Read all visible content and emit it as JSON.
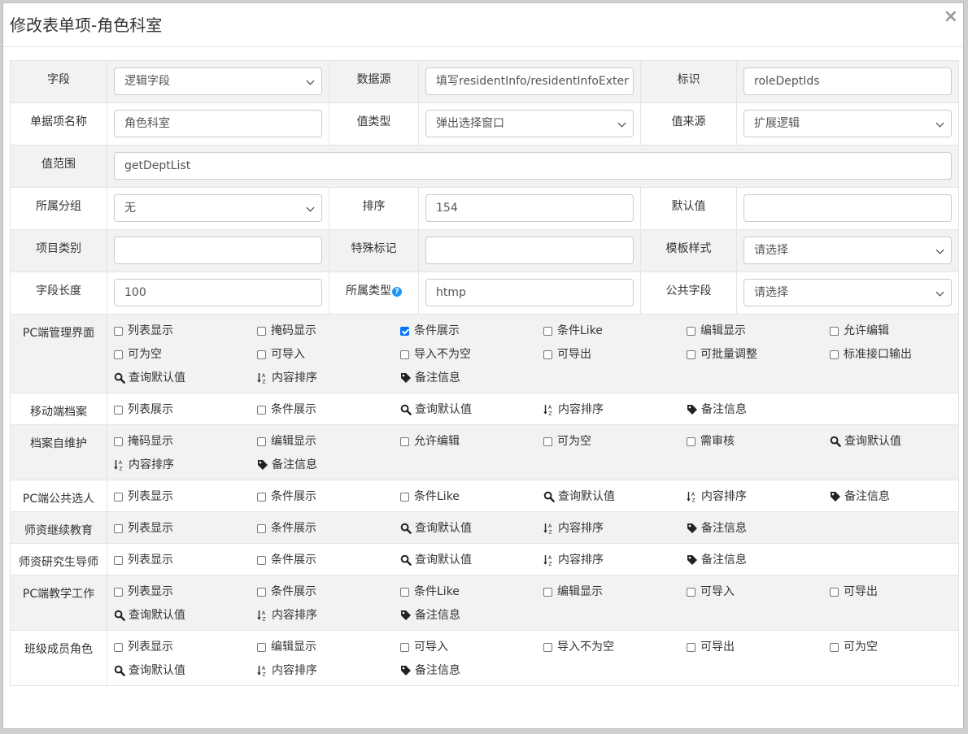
{
  "dialog": {
    "title": "修改表单项-角色科室",
    "close": "×"
  },
  "form": {
    "row1": {
      "field_label": "字段",
      "field_value": "逻辑字段",
      "datasource_label": "数据源",
      "datasource_placeholder": "填写residentInfo/residentInfoExter",
      "id_label": "标识",
      "id_value": "roleDeptIds"
    },
    "row2": {
      "name_label": "单据项名称",
      "name_value": "角色科室",
      "valtype_label": "值类型",
      "valtype_value": "弹出选择窗口",
      "valsource_label": "值来源",
      "valsource_value": "扩展逻辑"
    },
    "row3": {
      "range_label": "值范围",
      "range_value": "getDeptList"
    },
    "row4": {
      "group_label": "所属分组",
      "group_value": "无",
      "sort_label": "排序",
      "sort_value": "154",
      "default_label": "默认值",
      "default_value": ""
    },
    "row5": {
      "category_label": "项目类别",
      "category_value": "",
      "special_label": "特殊标记",
      "special_value": "",
      "template_label": "模板样式",
      "template_value": "请选择"
    },
    "row6": {
      "length_label": "字段长度",
      "length_value": "100",
      "type_label": "所属类型",
      "type_help": "?",
      "type_value": "htmp",
      "public_label": "公共字段",
      "public_value": "请选择"
    }
  },
  "sections": [
    {
      "label": "PC端管理界面",
      "items": [
        {
          "type": "cb",
          "label": "列表显示",
          "checked": false
        },
        {
          "type": "cb",
          "label": "掩码显示",
          "checked": false
        },
        {
          "type": "cb",
          "label": "条件展示",
          "checked": true
        },
        {
          "type": "cb",
          "label": "条件Like",
          "checked": false
        },
        {
          "type": "cb",
          "label": "编辑显示",
          "checked": false
        },
        {
          "type": "cb",
          "label": "允许编辑",
          "checked": false
        },
        {
          "type": "cb",
          "label": "可为空",
          "checked": false
        },
        {
          "type": "cb",
          "label": "可导入",
          "checked": false
        },
        {
          "type": "cb",
          "label": "导入不为空",
          "checked": false
        },
        {
          "type": "cb",
          "label": "可导出",
          "checked": false
        },
        {
          "type": "cb",
          "label": "可批量调整",
          "checked": false
        },
        {
          "type": "cb",
          "label": "标准接口输出",
          "checked": false
        },
        {
          "type": "search",
          "label": "查询默认值"
        },
        {
          "type": "sort",
          "label": "内容排序"
        },
        {
          "type": "tag",
          "label": "备注信息"
        }
      ]
    },
    {
      "label": "移动端档案",
      "items": [
        {
          "type": "cb",
          "label": "列表展示",
          "checked": false
        },
        {
          "type": "cb",
          "label": "条件展示",
          "checked": false
        },
        {
          "type": "search",
          "label": "查询默认值"
        },
        {
          "type": "sort",
          "label": "内容排序"
        },
        {
          "type": "tag",
          "label": "备注信息"
        }
      ]
    },
    {
      "label": "档案自维护",
      "items": [
        {
          "type": "cb",
          "label": "掩码显示",
          "checked": false
        },
        {
          "type": "cb",
          "label": "编辑显示",
          "checked": false
        },
        {
          "type": "cb",
          "label": "允许编辑",
          "checked": false
        },
        {
          "type": "cb",
          "label": "可为空",
          "checked": false
        },
        {
          "type": "cb",
          "label": "需审核",
          "checked": false
        },
        {
          "type": "search",
          "label": "查询默认值"
        },
        {
          "type": "sort",
          "label": "内容排序"
        },
        {
          "type": "tag",
          "label": "备注信息"
        }
      ]
    },
    {
      "label": "PC端公共选人",
      "items": [
        {
          "type": "cb",
          "label": "列表显示",
          "checked": false
        },
        {
          "type": "cb",
          "label": "条件展示",
          "checked": false
        },
        {
          "type": "cb",
          "label": "条件Like",
          "checked": false
        },
        {
          "type": "search",
          "label": "查询默认值"
        },
        {
          "type": "sort",
          "label": "内容排序"
        },
        {
          "type": "tag",
          "label": "备注信息"
        }
      ]
    },
    {
      "label": "师资继续教育",
      "items": [
        {
          "type": "cb",
          "label": "列表显示",
          "checked": false
        },
        {
          "type": "cb",
          "label": "条件展示",
          "checked": false
        },
        {
          "type": "search",
          "label": "查询默认值"
        },
        {
          "type": "sort",
          "label": "内容排序"
        },
        {
          "type": "tag",
          "label": "备注信息"
        }
      ]
    },
    {
      "label": "师资研究生导师",
      "items": [
        {
          "type": "cb",
          "label": "列表显示",
          "checked": false
        },
        {
          "type": "cb",
          "label": "条件展示",
          "checked": false
        },
        {
          "type": "search",
          "label": "查询默认值"
        },
        {
          "type": "sort",
          "label": "内容排序"
        },
        {
          "type": "tag",
          "label": "备注信息"
        }
      ]
    },
    {
      "label": "PC端教学工作",
      "items": [
        {
          "type": "cb",
          "label": "列表显示",
          "checked": false
        },
        {
          "type": "cb",
          "label": "条件展示",
          "checked": false
        },
        {
          "type": "cb",
          "label": "条件Like",
          "checked": false
        },
        {
          "type": "cb",
          "label": "编辑显示",
          "checked": false
        },
        {
          "type": "cb",
          "label": "可导入",
          "checked": false
        },
        {
          "type": "cb",
          "label": "可导出",
          "checked": false
        },
        {
          "type": "search",
          "label": "查询默认值"
        },
        {
          "type": "sort",
          "label": "内容排序"
        },
        {
          "type": "tag",
          "label": "备注信息"
        }
      ]
    },
    {
      "label": "班级成员角色",
      "items": [
        {
          "type": "cb",
          "label": "列表显示",
          "checked": false
        },
        {
          "type": "cb",
          "label": "编辑显示",
          "checked": false
        },
        {
          "type": "cb",
          "label": "可导入",
          "checked": false
        },
        {
          "type": "cb",
          "label": "导入不为空",
          "checked": false
        },
        {
          "type": "cb",
          "label": "可导出",
          "checked": false
        },
        {
          "type": "cb",
          "label": "可为空",
          "checked": false
        },
        {
          "type": "search",
          "label": "查询默认值"
        },
        {
          "type": "sort",
          "label": "内容排序"
        },
        {
          "type": "tag",
          "label": "备注信息"
        }
      ]
    }
  ],
  "colors": {
    "checked": "#0075ff",
    "help_badge": "#2196f3",
    "label_bg": "#f2f2f2"
  },
  "icons": {
    "search": "search-icon",
    "sort": "sort-icon",
    "tag": "tag-icon",
    "help": "question-circle-icon",
    "close": "close-icon",
    "dropdown": "chevron-down-icon"
  }
}
